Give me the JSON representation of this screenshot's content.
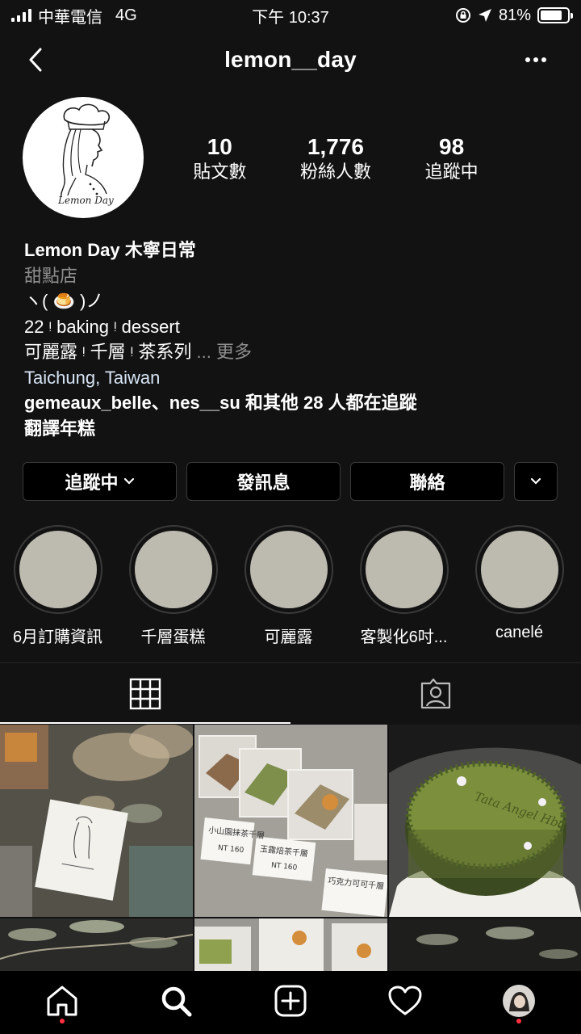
{
  "status_bar": {
    "carrier": "中華電信",
    "network": "4G",
    "time": "下午 10:37",
    "battery": "81%",
    "battery_level": 0.81
  },
  "header": {
    "username": "lemon__day"
  },
  "profile": {
    "stats": [
      {
        "value": "10",
        "label": "貼文數"
      },
      {
        "value": "1,776",
        "label": "粉絲人數"
      },
      {
        "value": "98",
        "label": "追蹤中"
      }
    ],
    "avatar_text": "Lemon Day",
    "bio": {
      "name": "Lemon Day 木寧日常",
      "category": "甜點店",
      "line1": "ヽ( 🍮 )ノ",
      "line2": "22 ᵎ baking ᵎ dessert",
      "line3": "可麗露 ᵎ 千層 ᵎ 茶系列",
      "more": "... 更多",
      "location": "Taichung, Taiwan",
      "followers_text": "gemeaux_belle、nes__su 和其他 28 人都在追蹤",
      "translate": "翻譯年糕"
    }
  },
  "actions": {
    "following": "追蹤中",
    "message": "發訊息",
    "contact": "聯絡"
  },
  "highlights": [
    {
      "label": "6月訂購資訊"
    },
    {
      "label": "千層蛋糕"
    },
    {
      "label": "可麗露"
    },
    {
      "label": "客製化6吋..."
    },
    {
      "label": "canelé"
    }
  ],
  "grid": {
    "photo2_tags": [
      "小山園抹茶千層",
      "玉露焙茶千層",
      "巧克力可可千層"
    ],
    "photo2_price": "NT 160",
    "photo3_cake_text": "Tata Angel Hbd"
  },
  "colors": {
    "background": "#121212",
    "highlight_fill": "#bdbab0",
    "notification_dot": "#ff3040",
    "link": "#d6e4f5"
  }
}
